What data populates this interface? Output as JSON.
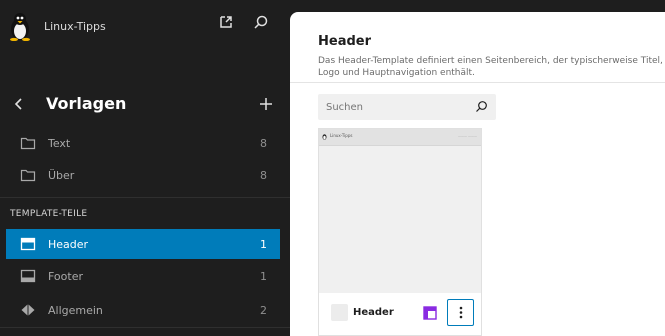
{
  "site": {
    "name": "Linux-Tipps"
  },
  "sidebar": {
    "title": "Vorlagen",
    "items": [
      {
        "label": "Text",
        "count": "8",
        "icon": "folder-icon"
      },
      {
        "label": "Über",
        "count": "8",
        "icon": "folder-icon"
      }
    ],
    "section_heading": "TEMPLATE-TEILE",
    "parts": [
      {
        "label": "Header",
        "count": "1",
        "icon": "header-icon",
        "active": true
      },
      {
        "label": "Footer",
        "count": "1",
        "icon": "footer-icon"
      },
      {
        "label": "Allgemein",
        "count": "2",
        "icon": "diamond-icon"
      }
    ]
  },
  "main": {
    "title": "Header",
    "description": "Das Header-Template definiert einen Seitenbereich, der typischerweise Titel, Logo und Hauptnavigation enthält.",
    "search": {
      "placeholder": "Suchen",
      "value": ""
    },
    "card": {
      "name": "Header",
      "preview_site_name": "Linux-Tipps"
    }
  },
  "colors": {
    "accent": "#007cba",
    "sidebar_bg": "#1e1e1e",
    "layout_icon": "#8a2be2"
  }
}
